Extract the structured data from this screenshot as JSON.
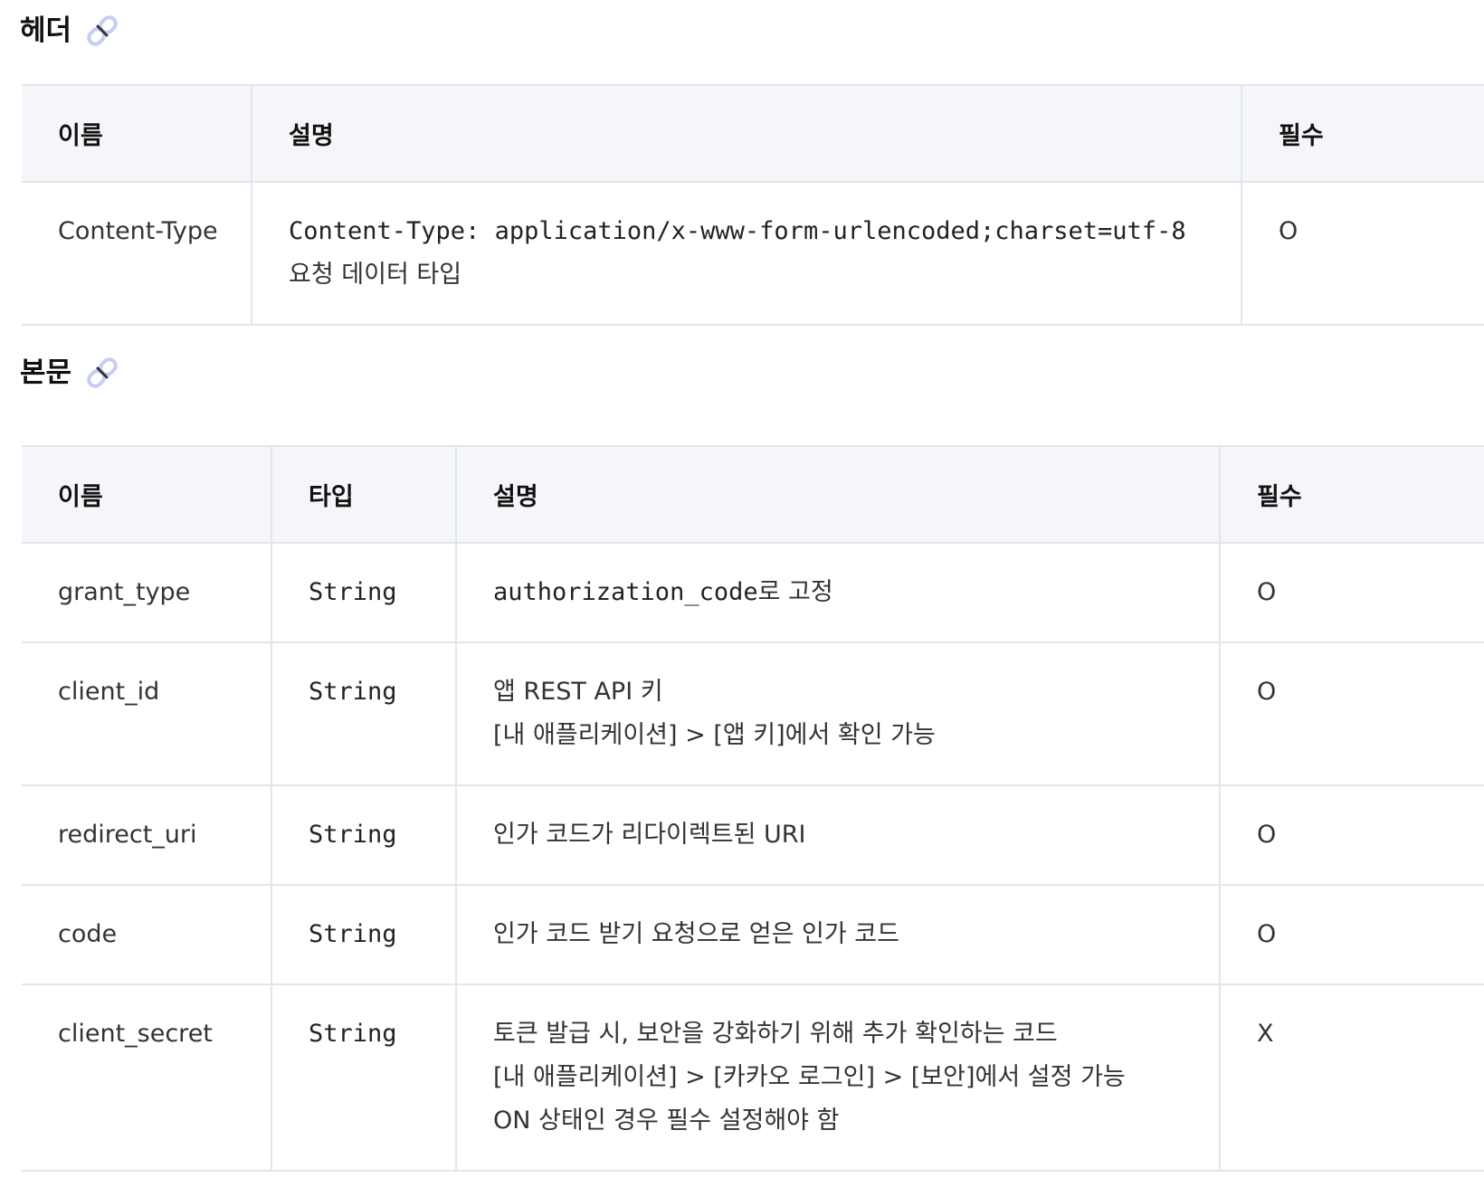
{
  "header_section": {
    "title": "헤더",
    "columns": [
      "이름",
      "설명",
      "필수"
    ],
    "rows": [
      {
        "name": "Content-Type",
        "desc_code": "Content-Type: application/x-www-form-urlencoded;charset=utf-8",
        "desc_text": "요청 데이터 타입",
        "required": "O"
      }
    ]
  },
  "body_section": {
    "title": "본문",
    "columns": [
      "이름",
      "타입",
      "설명",
      "필수"
    ],
    "rows": [
      {
        "name": "grant_type",
        "type": "String",
        "desc_code": "authorization_code",
        "desc_suffix": "로 고정",
        "required": "O"
      },
      {
        "name": "client_id",
        "type": "String",
        "desc_lines": [
          "앱 REST API 키",
          "[내 애플리케이션] > [앱 키]에서 확인 가능"
        ],
        "required": "O"
      },
      {
        "name": "redirect_uri",
        "type": "String",
        "desc_lines": [
          "인가 코드가 리다이렉트된 URI"
        ],
        "required": "O"
      },
      {
        "name": "code",
        "type": "String",
        "desc_lines": [
          "인가 코드 받기 요청으로 얻은 인가 코드"
        ],
        "required": "O"
      },
      {
        "name": "client_secret",
        "type": "String",
        "desc_lines": [
          "토큰 발급 시, 보안을 강화하기 위해 추가 확인하는 코드",
          "[내 애플리케이션] > [카카오 로그인] > [보안]에서 설정 가능",
          "ON 상태인 경우 필수 설정해야 함"
        ],
        "required": "X"
      }
    ]
  },
  "icons": {
    "anchor": "link-icon"
  },
  "colors": {
    "header_bg": "#f5f6f9",
    "border": "#e3e5ec",
    "icon": "#aab3e8"
  }
}
